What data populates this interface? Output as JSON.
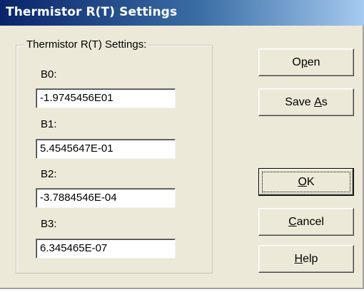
{
  "window": {
    "title": "Thermistor R(T) Settings"
  },
  "group": {
    "label": "Thermistor R(T) Settings:"
  },
  "fields": [
    {
      "label": "B0:",
      "value": "-1.9745456E01"
    },
    {
      "label": "B1:",
      "value": "5.4545647E-01"
    },
    {
      "label": "B2:",
      "value": "-3.7884546E-04"
    },
    {
      "label": "B3:",
      "value": "6.345465E-07"
    }
  ],
  "buttons": {
    "open": {
      "before": "O",
      "accel": "p",
      "after": "en"
    },
    "save_as": {
      "before": "Save ",
      "accel": "A",
      "after": "s"
    },
    "ok": {
      "before": "",
      "accel": "O",
      "after": "K"
    },
    "cancel": {
      "before": "",
      "accel": "C",
      "after": "ancel"
    },
    "help": {
      "before": "",
      "accel": "H",
      "after": "elp"
    }
  }
}
